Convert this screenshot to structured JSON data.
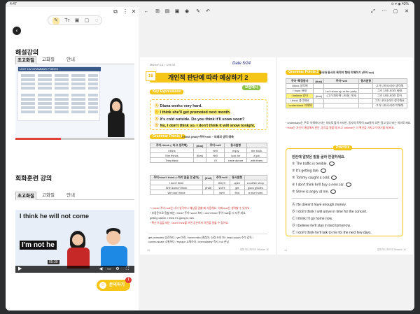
{
  "status": {
    "time": "4:47",
    "right": "⊙ ▾ ◉ 43%"
  },
  "left": {
    "commentary_title": "해설강의",
    "tabs1": [
      "초고화질",
      "고화질",
      "안내"
    ],
    "sheet_title": "UNIT 152 GRAMMAR POINTS",
    "practice_title": "회화훈련 강의",
    "tabs2": [
      "초고화질",
      "고화질",
      "안내"
    ],
    "video2": {
      "caption_top": "I think he will not come",
      "caption_bottom": "I'm not he",
      "time": "05:39"
    },
    "inquiry_label": "문의하기",
    "inquiry_badge": "1"
  },
  "viewer": {
    "toolbar_right_label": "",
    "page_left": {
      "header": "Mission 16 > Unit 34",
      "date_scribble": "Date 5/24",
      "lesson_num": "16",
      "title": "개인적 판단에 따라 예상하기 2",
      "key_pill": "Key Expressions",
      "side_pill": "모범예시",
      "examples": [
        {
          "mark": "Ⓐ",
          "text": "Diana works very hard.",
          "kor": "다이애나는 열심히 일해."
        },
        {
          "mark": "Ⓑ",
          "text": "I think she'll get promoted next month.",
          "kor": "내 생각에 다음 달에 승진할 것 같아."
        },
        {
          "mark": "Ⓐ",
          "text": "It's cold outside. Do you think it'll snow soon?",
          "kor": "밖이 추워. 곧 눈이 올 것 같아?"
        },
        {
          "mark": "Ⓑ",
          "text": "No, I don't think so. I don't think it will snow tonight.",
          "kor": "아니, 오늘 밤엔 안 올 것 같아."
        }
      ],
      "grammar_pill": "Grammar Points 1",
      "grammar_title": "I think (that)+주어+will ~ 미래의 생각 예측",
      "table1_headers": [
        "주어+think\n(~라고 생각해)",
        "(that)",
        "주어+will",
        "동사원형",
        ""
      ],
      "table1_rows": [
        [
          "I think",
          "",
          "he'll",
          "enjoy",
          "the book."
        ],
        [
          "She thinks",
          "(that)",
          "he'll",
          "look for",
          "a job."
        ],
        [
          "They think",
          "",
          "I'll",
          "have dinner",
          "with them."
        ]
      ],
      "table2_headers": [
        "주어+don't think\n(~하지 않을 것 같아)",
        "(that)",
        "주어+will",
        "동사원형",
        ""
      ],
      "table2_rows": [
        [
          "I don't think",
          "",
          "they'll",
          "open",
          "a coffee shop."
        ],
        [
          "She doesn't think",
          "(that)",
          "she'll",
          "get",
          "good grades."
        ],
        [
          "We don't think",
          "",
          "we'll",
          "find",
          "a nice hotel."
        ]
      ],
      "notes": [
        "* I think+주어+will은 나의 생각이나 예상을 말할 때 사용해요. 이때 that은 생략할 수 있어요.",
        "* 부정문으로 말할 때는 I think+주어+won't 보다 I don't think+주어+will을 더 자주 써요.",
        "  getting darker. I think it's going to rain.",
        "* 확신이 없을 때는 I don't think를 쓰면 공손하게 의견을 말할 수 있어요."
      ],
      "vocab1": "get promoted 승진하다 / yet 아직 / never mind 괜찮아, 신경 쓰지 마 / head coach 수석 감독 / ",
      "vocab2": "communicate 소통하다 / replace 교체하다 / immediately 즉시 / sir 손님",
      "footer_left": "15",
      "footer_right": "영파 미니하이오 Mission 16"
    },
    "page_right": {
      "grammar_pill": "Grammar Points 2",
      "grammar_title": "동사와 동사의 목적어 형태 이해하기 (주어 but)",
      "table_headers": [
        "주어+확정동사",
        "(that)",
        "주어+will",
        "동사원형",
        ""
      ],
      "table_rows": [
        [
          "I think 생각해",
          "",
          "",
          "",
          "그가 나타나리라 생각해."
        ],
        [
          "I hope 바래",
          "",
          "he'll show up at the party.",
          "",
          "그가 나타나리라 바래."
        ],
        [
          "I believe 믿어",
          "(that)",
          "(그가 파티에 나타날 거야)",
          "",
          "그가 나타나리라 믿어."
        ],
        [
          "I think 생각해요",
          "",
          "",
          "",
          "그가 나타나리라 생각해요."
        ],
        [
          "I understand 이해해",
          "",
          "",
          "",
          "그가 나타나리라 이해해."
        ]
      ],
      "note1": "* understand는 주로 '이해하다'라는 의미로 많이 쓰지만, 동사의 목적어 that절이 오면 '알고 있다'라는 의미로 써요.",
      "note2": "* think는 자신이 예상해서 판단, 생각을 말할 때 쓰고, believe는 더 확신을 가지고 이야기할 때 써요.",
      "practice_pill": "Practice",
      "practice_intro": "빈칸에 알맞은 말을 골라 연결하세요.",
      "items": [
        "The traffic is terrible.",
        "It's getting late.",
        "Tommy caught a cold.",
        "I don't think he'll buy a new car.",
        "Steve is angry at me."
      ],
      "sentences": [
        "He doesn't have enough money.",
        "I don't think I will arrive in time for the concert.",
        "I think I'll go home now.",
        "I believe he'll stay in bed tomorrow.",
        "I don't think he'll talk to me for the next few days."
      ],
      "footer_left": "14",
      "footer_right": "영파 미니하이오 Mission 16"
    }
  },
  "colors": {
    "accent": "#f5c518",
    "highlight": "#fff27a",
    "red": "#e53935"
  }
}
